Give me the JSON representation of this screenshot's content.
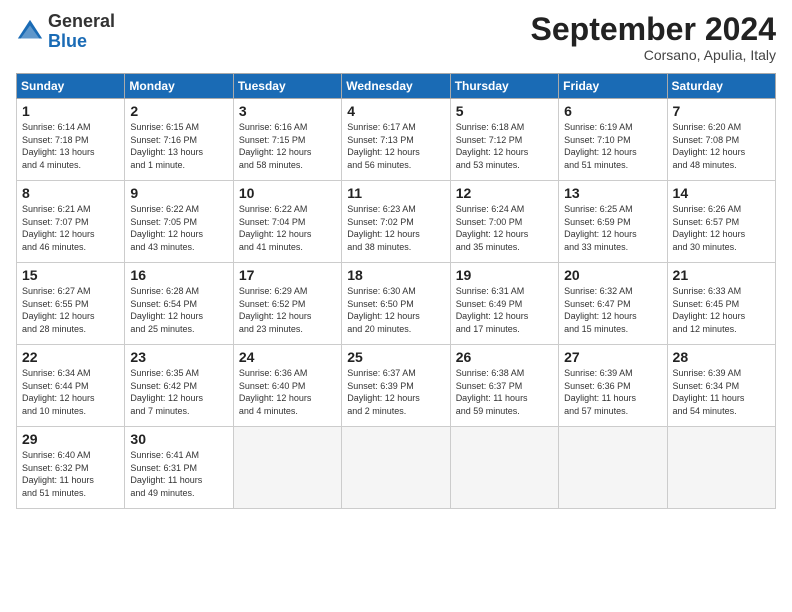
{
  "header": {
    "logo_general": "General",
    "logo_blue": "Blue",
    "month_title": "September 2024",
    "location": "Corsano, Apulia, Italy"
  },
  "weekdays": [
    "Sunday",
    "Monday",
    "Tuesday",
    "Wednesday",
    "Thursday",
    "Friday",
    "Saturday"
  ],
  "weeks": [
    [
      {
        "day": "1",
        "info": "Sunrise: 6:14 AM\nSunset: 7:18 PM\nDaylight: 13 hours\nand 4 minutes."
      },
      {
        "day": "2",
        "info": "Sunrise: 6:15 AM\nSunset: 7:16 PM\nDaylight: 13 hours\nand 1 minute."
      },
      {
        "day": "3",
        "info": "Sunrise: 6:16 AM\nSunset: 7:15 PM\nDaylight: 12 hours\nand 58 minutes."
      },
      {
        "day": "4",
        "info": "Sunrise: 6:17 AM\nSunset: 7:13 PM\nDaylight: 12 hours\nand 56 minutes."
      },
      {
        "day": "5",
        "info": "Sunrise: 6:18 AM\nSunset: 7:12 PM\nDaylight: 12 hours\nand 53 minutes."
      },
      {
        "day": "6",
        "info": "Sunrise: 6:19 AM\nSunset: 7:10 PM\nDaylight: 12 hours\nand 51 minutes."
      },
      {
        "day": "7",
        "info": "Sunrise: 6:20 AM\nSunset: 7:08 PM\nDaylight: 12 hours\nand 48 minutes."
      }
    ],
    [
      {
        "day": "8",
        "info": "Sunrise: 6:21 AM\nSunset: 7:07 PM\nDaylight: 12 hours\nand 46 minutes."
      },
      {
        "day": "9",
        "info": "Sunrise: 6:22 AM\nSunset: 7:05 PM\nDaylight: 12 hours\nand 43 minutes."
      },
      {
        "day": "10",
        "info": "Sunrise: 6:22 AM\nSunset: 7:04 PM\nDaylight: 12 hours\nand 41 minutes."
      },
      {
        "day": "11",
        "info": "Sunrise: 6:23 AM\nSunset: 7:02 PM\nDaylight: 12 hours\nand 38 minutes."
      },
      {
        "day": "12",
        "info": "Sunrise: 6:24 AM\nSunset: 7:00 PM\nDaylight: 12 hours\nand 35 minutes."
      },
      {
        "day": "13",
        "info": "Sunrise: 6:25 AM\nSunset: 6:59 PM\nDaylight: 12 hours\nand 33 minutes."
      },
      {
        "day": "14",
        "info": "Sunrise: 6:26 AM\nSunset: 6:57 PM\nDaylight: 12 hours\nand 30 minutes."
      }
    ],
    [
      {
        "day": "15",
        "info": "Sunrise: 6:27 AM\nSunset: 6:55 PM\nDaylight: 12 hours\nand 28 minutes."
      },
      {
        "day": "16",
        "info": "Sunrise: 6:28 AM\nSunset: 6:54 PM\nDaylight: 12 hours\nand 25 minutes."
      },
      {
        "day": "17",
        "info": "Sunrise: 6:29 AM\nSunset: 6:52 PM\nDaylight: 12 hours\nand 23 minutes."
      },
      {
        "day": "18",
        "info": "Sunrise: 6:30 AM\nSunset: 6:50 PM\nDaylight: 12 hours\nand 20 minutes."
      },
      {
        "day": "19",
        "info": "Sunrise: 6:31 AM\nSunset: 6:49 PM\nDaylight: 12 hours\nand 17 minutes."
      },
      {
        "day": "20",
        "info": "Sunrise: 6:32 AM\nSunset: 6:47 PM\nDaylight: 12 hours\nand 15 minutes."
      },
      {
        "day": "21",
        "info": "Sunrise: 6:33 AM\nSunset: 6:45 PM\nDaylight: 12 hours\nand 12 minutes."
      }
    ],
    [
      {
        "day": "22",
        "info": "Sunrise: 6:34 AM\nSunset: 6:44 PM\nDaylight: 12 hours\nand 10 minutes."
      },
      {
        "day": "23",
        "info": "Sunrise: 6:35 AM\nSunset: 6:42 PM\nDaylight: 12 hours\nand 7 minutes."
      },
      {
        "day": "24",
        "info": "Sunrise: 6:36 AM\nSunset: 6:40 PM\nDaylight: 12 hours\nand 4 minutes."
      },
      {
        "day": "25",
        "info": "Sunrise: 6:37 AM\nSunset: 6:39 PM\nDaylight: 12 hours\nand 2 minutes."
      },
      {
        "day": "26",
        "info": "Sunrise: 6:38 AM\nSunset: 6:37 PM\nDaylight: 11 hours\nand 59 minutes."
      },
      {
        "day": "27",
        "info": "Sunrise: 6:39 AM\nSunset: 6:36 PM\nDaylight: 11 hours\nand 57 minutes."
      },
      {
        "day": "28",
        "info": "Sunrise: 6:39 AM\nSunset: 6:34 PM\nDaylight: 11 hours\nand 54 minutes."
      }
    ],
    [
      {
        "day": "29",
        "info": "Sunrise: 6:40 AM\nSunset: 6:32 PM\nDaylight: 11 hours\nand 51 minutes."
      },
      {
        "day": "30",
        "info": "Sunrise: 6:41 AM\nSunset: 6:31 PM\nDaylight: 11 hours\nand 49 minutes."
      },
      {
        "day": "",
        "info": ""
      },
      {
        "day": "",
        "info": ""
      },
      {
        "day": "",
        "info": ""
      },
      {
        "day": "",
        "info": ""
      },
      {
        "day": "",
        "info": ""
      }
    ]
  ]
}
